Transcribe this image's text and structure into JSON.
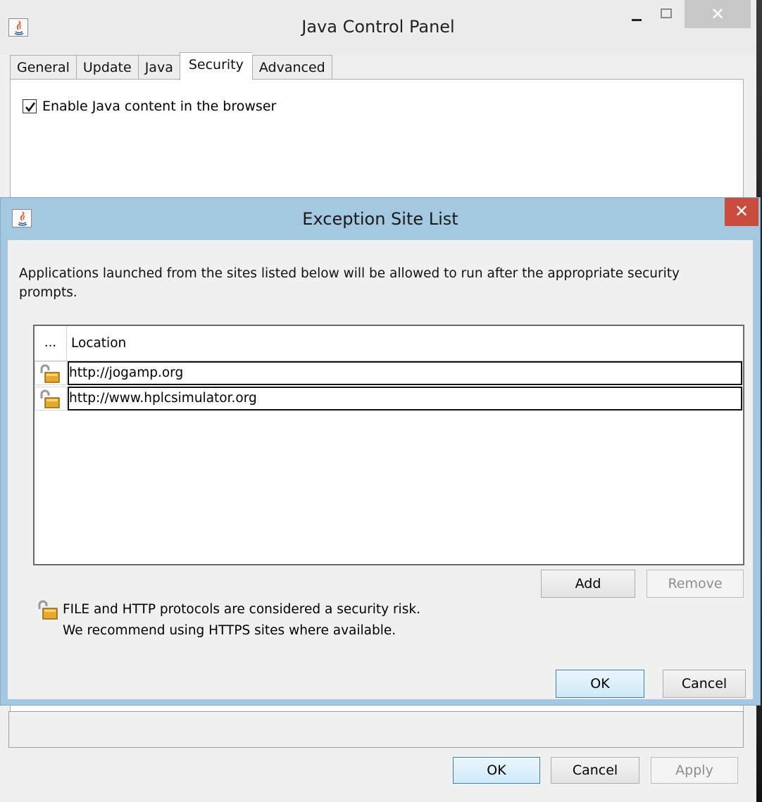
{
  "control_panel": {
    "title": "Java Control Panel",
    "close_glyph": "✕",
    "tabs": [
      {
        "label": "General"
      },
      {
        "label": "Update"
      },
      {
        "label": "Java"
      },
      {
        "label": "Security",
        "active": true
      },
      {
        "label": "Advanced"
      }
    ],
    "enable_java_label": "Enable Java content in the browser",
    "enable_java_checked": true,
    "buttons": {
      "ok": "OK",
      "cancel": "Cancel",
      "apply": "Apply"
    }
  },
  "exception_dialog": {
    "title": "Exception Site List",
    "close_glyph": "✕",
    "description": "Applications launched from the sites listed below will be allowed to run after the appropriate security prompts.",
    "table": {
      "columns": [
        "...",
        "Location"
      ],
      "rows": [
        {
          "icon": "unlocked-padlock-icon",
          "location": "http://jogamp.org"
        },
        {
          "icon": "unlocked-padlock-icon",
          "location": "http://www.hplcsimulator.org"
        }
      ]
    },
    "add_label": "Add",
    "remove_label": "Remove",
    "warning_line_1": "FILE and HTTP protocols are considered a security risk.",
    "warning_line_2": "We recommend using HTTPS sites where available.",
    "ok_label": "OK",
    "cancel_label": "Cancel"
  },
  "colors": {
    "dialog_frame": "#a3c8df",
    "close_button": "#c94c3f",
    "default_button_border": "#3c7fb1"
  }
}
